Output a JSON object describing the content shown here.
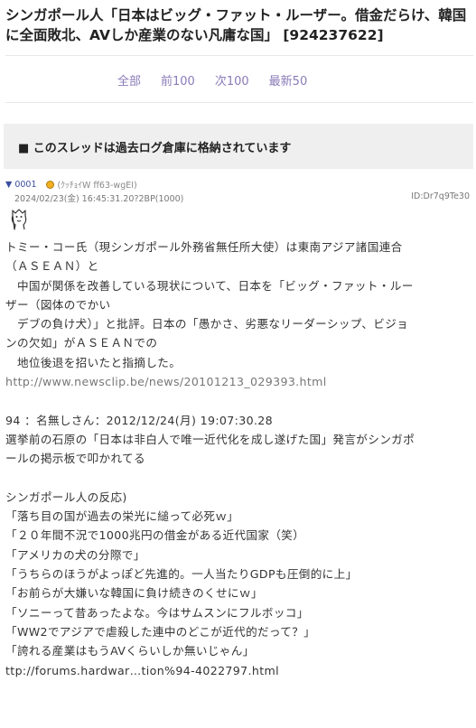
{
  "thread": {
    "title": "シンガポール人「日本はビッグ・ファット・ルーザー。借金だらけ、韓国に全面敗北、AVしか産業のない凡庸な国」 [924237622]"
  },
  "nav": {
    "items": [
      "全部",
      "前100",
      "次100",
      "最新50"
    ]
  },
  "archive_notice": "■ このスレッドは過去ログ倉庫に格納されています",
  "post": {
    "marker": "▼",
    "number": "0001",
    "name": "(ｸｯﾁｮｲW ff63-wgEI)",
    "date": "2024/02/23(金) 16:45:31.20?2BP(1000)",
    "id": "ID:Dr7q9Te30",
    "badge_color": "#f0b020",
    "lines": [
      "トミー・コー氏（現シンガポール外務省無任所大使）は東南アジア諸国連合",
      "（ＡＳＥＡＮ）と",
      "　中国が関係を改善している現状について、日本を「ビッグ・ファット・ルー",
      "ザー（図体のでかい",
      "　デブの負け犬）」と批評。日本の「愚かさ、劣悪なリーダーシップ、ビジョ",
      "ンの欠如」がＡＳＥＡＮでの",
      "　地位後退を招いたと指摘した。",
      "http://www.newsclip.be/news/20101213_029393.html",
      "",
      "94 ：名無しさん：2012/12/24(月) 19:07:30.28",
      "選挙前の石原の「日本は非白人で唯一近代化を成し遂げた国」発言がシンガポ",
      "ールの掲示板で叩かれてる",
      "",
      "シンガポール人の反応)",
      "「落ち目の国が過去の栄光に縋って必死ｗ」",
      "「２０年間不況で1000兆円の借金がある近代国家（笑）",
      "「アメリカの犬の分際で」",
      "「うちらのほうがよっぽど先進的。一人当たりGDPも圧倒的に上」",
      "「お前らが大嫌いな韓国に負け続きのくせにｗ」",
      "「ソニーって昔あったよな。今はサムスンにフルボッコ」",
      "「WW2でアジアで虐殺した連中のどこが近代的だって？」",
      "「誇れる産業はもうAVくらいしか無いじゃん」",
      "ttp://forums.hardwar…tion%94-4022797.html"
    ]
  }
}
